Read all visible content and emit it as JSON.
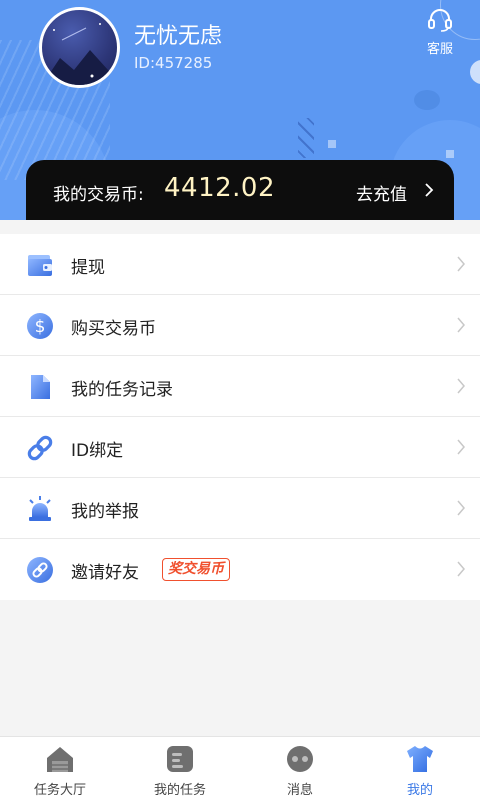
{
  "profile": {
    "username": "无忧无虑",
    "user_id": "ID:457285",
    "service_label": "客服"
  },
  "balance": {
    "label": "我的交易币:",
    "value": "4412.02",
    "recharge_label": "去充值"
  },
  "menu": {
    "items": [
      {
        "label": "提现",
        "icon": "wallet-icon"
      },
      {
        "label": "购买交易币",
        "icon": "dollar-coin-icon"
      },
      {
        "label": "我的任务记录",
        "icon": "document-icon"
      },
      {
        "label": "ID绑定",
        "icon": "link-icon"
      },
      {
        "label": "我的举报",
        "icon": "alarm-light-icon"
      },
      {
        "label": "邀请好友",
        "icon": "invite-link-icon",
        "badge": "奖交易币"
      }
    ]
  },
  "tabbar": {
    "tabs": [
      {
        "label": "任务大厅",
        "icon": "house-icon"
      },
      {
        "label": "我的任务",
        "icon": "task-list-icon"
      },
      {
        "label": "消息",
        "icon": "message-bubble-icon"
      },
      {
        "label": "我的",
        "icon": "tshirt-icon",
        "active": true
      }
    ]
  },
  "colors": {
    "header_bg": "#5c98f2",
    "accent": "#3a78e6",
    "balance_value": "#fff3c4",
    "badge": "#f0502e"
  }
}
